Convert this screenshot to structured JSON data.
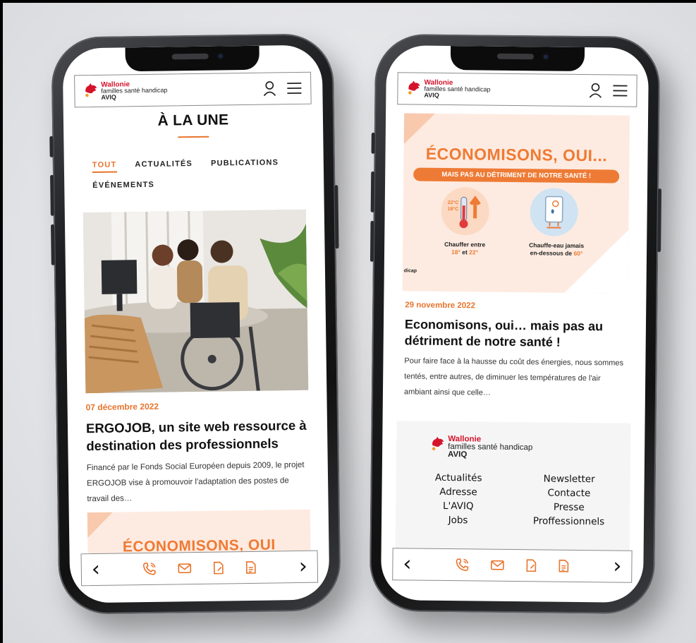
{
  "brand": {
    "name": "Wallonie",
    "tagline": "familles santé handicap",
    "short": "AVIQ",
    "accent": "#e8742c",
    "red": "#d4132a"
  },
  "left_screen": {
    "section_title": "À LA UNE",
    "tabs": [
      {
        "label": "TOUT",
        "active": true
      },
      {
        "label": "ACTUALITÉS",
        "active": false
      },
      {
        "label": "PUBLICATIONS",
        "active": false
      },
      {
        "label": "ÉVÉNEMENTS",
        "active": false
      }
    ],
    "article": {
      "date": "07 décembre 2022",
      "title": "ERGOJOB, un site web ressource à destination des professionnels",
      "excerpt": "Financé par le Fonds Social Européen depuis 2009, le projet ERGOJOB vise à promouvoir l'adaptation des postes de travail des…"
    },
    "promo_peek": "ÉCONOMISONS, OUI"
  },
  "right_screen": {
    "promo": {
      "headline": "ÉCONOMISONS, OUI...",
      "band": "MAIS PAS AU DÉTRIMENT DE NOTRE SANTÉ !",
      "thermo_label_a": "22°C",
      "thermo_label_b": "18°C",
      "caption_left_1": "Chauffer entre",
      "caption_left_2a": "18°",
      "caption_left_2b": " et ",
      "caption_left_2c": "22°",
      "caption_right_1": "Chauffe-eau jamais",
      "caption_right_2a": "en-dessous de ",
      "caption_right_2b": "60°",
      "corner_text": "dicap"
    },
    "article": {
      "date": "29 novembre 2022",
      "title": "Economisons, oui… mais pas au détriment de notre santé !",
      "excerpt": "Pour faire face à la hausse du coût des énergies, nous sommes tentés, entre autres, de diminuer les températures de l'air ambiant ainsi que celle…"
    },
    "footer": {
      "links": [
        "Actualités",
        "Newsletter",
        "Adresse",
        "Contacte",
        "L'AVIQ",
        "Presse",
        "Jobs",
        "Proffessionnels"
      ]
    }
  },
  "icons": {
    "user": "user-icon",
    "menu": "hamburger-menu-icon",
    "prev": "chevron-left-icon",
    "next": "chevron-right-icon",
    "phone": "phone-icon",
    "mail": "mail-icon",
    "doc": "document-icon",
    "form": "form-icon"
  }
}
